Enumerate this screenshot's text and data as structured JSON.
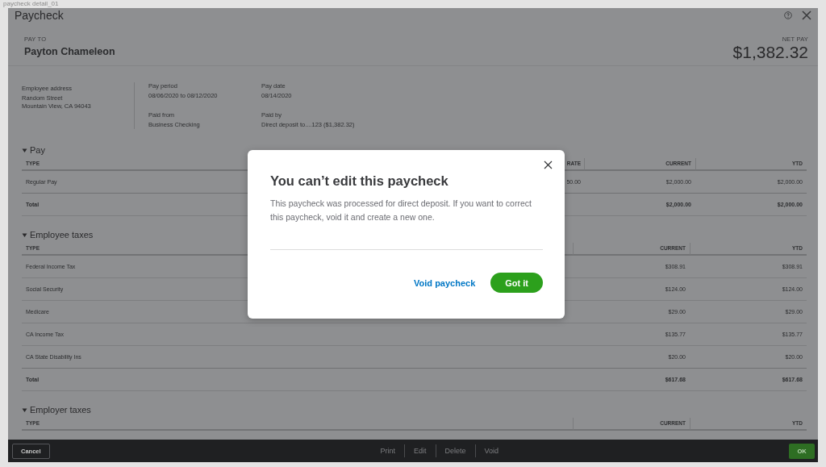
{
  "caption": "paycheck detail_01",
  "window": {
    "title": "Paycheck"
  },
  "pay_to": {
    "label": "PAY TO",
    "name": "Payton Chameleon"
  },
  "net_pay": {
    "label": "NET PAY",
    "amount": "$1,382.32"
  },
  "employee_address": {
    "label": "Employee address",
    "lines": [
      "Random Street",
      "Mountain View, CA 94043"
    ]
  },
  "details": [
    {
      "label": "Pay period",
      "value": "08/06/2020 to 08/12/2020"
    },
    {
      "label": "Pay date",
      "value": "08/14/2020"
    },
    {
      "label": "Paid from",
      "value": "Business Checking"
    },
    {
      "label": "Paid by",
      "value": "Direct deposit to....123 ($1,382.32)"
    }
  ],
  "sections": [
    {
      "title": "Pay",
      "expanded": true,
      "columns": [
        {
          "header": "TYPE",
          "kind": "type"
        },
        {
          "header": "RATE",
          "kind": "rate"
        },
        {
          "header": "CURRENT",
          "kind": "amount"
        },
        {
          "header": "YTD",
          "kind": "amount"
        }
      ],
      "rows": [
        {
          "kind": "item",
          "label": "Regular Pay",
          "rate": "50.00",
          "amounts": [
            "$2,000.00",
            "$2,000.00"
          ]
        },
        {
          "kind": "total",
          "label": "Total",
          "amounts": [
            "$2,000.00",
            "$2,000.00"
          ]
        }
      ]
    },
    {
      "title": "Employee taxes",
      "expanded": true,
      "columns": [
        {
          "header": "TYPE",
          "kind": "type"
        },
        {
          "header": "CURRENT",
          "kind": "amount"
        },
        {
          "header": "YTD",
          "kind": "amount"
        }
      ],
      "rows": [
        {
          "kind": "item",
          "label": "Federal Income Tax",
          "amounts": [
            "$308.91",
            "$308.91"
          ]
        },
        {
          "kind": "item",
          "label": "Social Security",
          "amounts": [
            "$124.00",
            "$124.00"
          ]
        },
        {
          "kind": "item",
          "label": "Medicare",
          "amounts": [
            "$29.00",
            "$29.00"
          ]
        },
        {
          "kind": "item",
          "label": "CA Income Tax",
          "amounts": [
            "$135.77",
            "$135.77"
          ]
        },
        {
          "kind": "item",
          "label": "CA State Disability Ins",
          "amounts": [
            "$20.00",
            "$20.00"
          ]
        },
        {
          "kind": "total",
          "label": "Total",
          "amounts": [
            "$617.68",
            "$617.68"
          ]
        }
      ]
    },
    {
      "title": "Employer taxes",
      "expanded": true,
      "columns": [
        {
          "header": "TYPE",
          "kind": "type"
        },
        {
          "header": "CURRENT",
          "kind": "amount"
        },
        {
          "header": "YTD",
          "kind": "amount"
        }
      ]
    }
  ],
  "footer": {
    "cancel": "Cancel",
    "actions": [
      "Print",
      "Edit",
      "Delete",
      "Void"
    ],
    "ok": "OK"
  },
  "dialog": {
    "title": "You can’t edit this paycheck",
    "body": "This paycheck was processed for direct deposit. If you want to correct this paycheck, void it and create a new one.",
    "secondary": "Void paycheck",
    "primary": "Got it"
  }
}
